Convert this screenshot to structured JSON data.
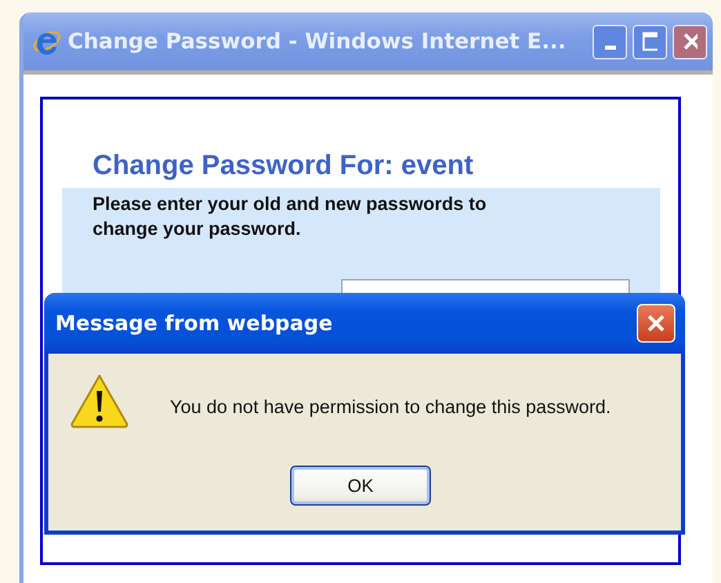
{
  "window": {
    "title": "Change Password - Windows Internet E..."
  },
  "page": {
    "heading": "Change Password For: event",
    "instructions": "Please enter your old and new passwords to change your password."
  },
  "dialog": {
    "title": "Message from webpage",
    "message": "You do not have permission to change this password.",
    "buttons": [
      "OK"
    ]
  }
}
